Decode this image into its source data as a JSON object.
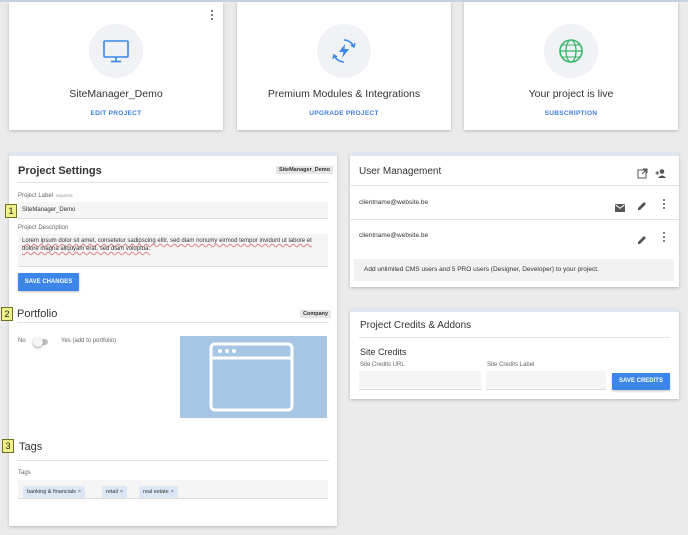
{
  "top_cards": [
    {
      "title": "SiteManager_Demo",
      "link": "EDIT PROJECT",
      "icon": "monitor-icon"
    },
    {
      "title": "Premium Modules & Integrations",
      "link": "UPGRADE PROJECT",
      "icon": "lightning-refresh-icon"
    },
    {
      "title": "Your project is live",
      "link": "SUBSCRIPTION",
      "icon": "globe-icon"
    }
  ],
  "project_settings": {
    "title": "Project Settings",
    "badge": "SiteManager_Demo",
    "label_field": {
      "label": "Project Label",
      "required": "required",
      "value": "SiteManager_Demo"
    },
    "description_field": {
      "label": "Project Description",
      "value": "Lorem ipsum dolor sit amet, consetetur sadipscing elitr, sed diam nonumy eirmod tempor invidunt ut labore et dolore magna aliquyam erat, sed diam voluptua."
    },
    "save_button": "SAVE CHANGES"
  },
  "portfolio": {
    "title": "Portfolio",
    "badge": "Company",
    "toggle_off": "No",
    "toggle_on": "Yes (add to portfolio)",
    "enabled": false
  },
  "tags": {
    "title": "Tags",
    "field_label": "Tags",
    "items": [
      "banking & financials",
      "retail",
      "real estate"
    ],
    "remove_glyph": "×"
  },
  "callouts": [
    "1",
    "2",
    "3"
  ],
  "user_management": {
    "title": "User Management",
    "users": [
      {
        "email": "clientname@website.be",
        "has_mail_icon": true
      },
      {
        "email": "clientname@website.be",
        "has_mail_icon": false
      }
    ],
    "note": "Add unlimited CMS users and 5 PRO users (Designer, Developer) to your project."
  },
  "credits": {
    "title": "Project Credits & Addons",
    "subtitle": "Site Credits",
    "url_label": "Site Credits URL",
    "label_label": "Site Credits Label",
    "url_value": "",
    "label_value": "",
    "save_button": "SAVE CREDITS"
  },
  "colors": {
    "accent": "#3b86e8",
    "link": "#3b7dd8",
    "callout": "#eef089",
    "portfolio_image": "#a7c6e3"
  }
}
